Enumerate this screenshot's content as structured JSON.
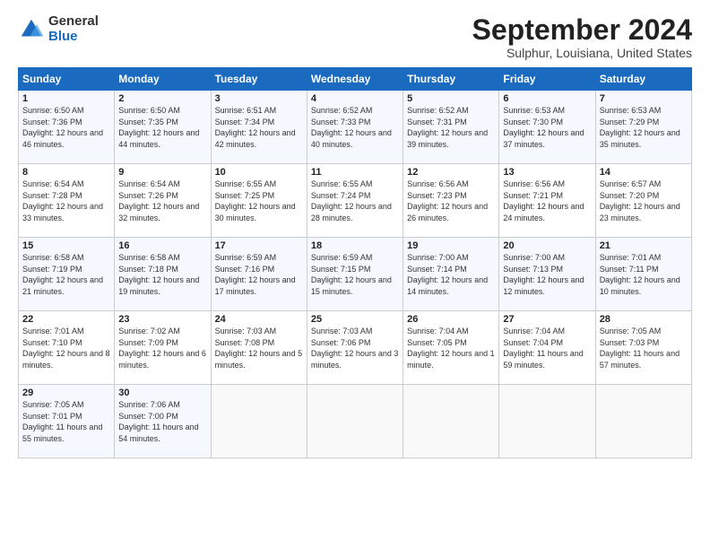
{
  "logo": {
    "general": "General",
    "blue": "Blue"
  },
  "header": {
    "month": "September 2024",
    "location": "Sulphur, Louisiana, United States"
  },
  "weekdays": [
    "Sunday",
    "Monday",
    "Tuesday",
    "Wednesday",
    "Thursday",
    "Friday",
    "Saturday"
  ],
  "weeks": [
    [
      {
        "day": 1,
        "sunrise": "6:50 AM",
        "sunset": "7:36 PM",
        "daylight": "12 hours and 46 minutes."
      },
      {
        "day": 2,
        "sunrise": "6:50 AM",
        "sunset": "7:35 PM",
        "daylight": "12 hours and 44 minutes."
      },
      {
        "day": 3,
        "sunrise": "6:51 AM",
        "sunset": "7:34 PM",
        "daylight": "12 hours and 42 minutes."
      },
      {
        "day": 4,
        "sunrise": "6:52 AM",
        "sunset": "7:33 PM",
        "daylight": "12 hours and 40 minutes."
      },
      {
        "day": 5,
        "sunrise": "6:52 AM",
        "sunset": "7:31 PM",
        "daylight": "12 hours and 39 minutes."
      },
      {
        "day": 6,
        "sunrise": "6:53 AM",
        "sunset": "7:30 PM",
        "daylight": "12 hours and 37 minutes."
      },
      {
        "day": 7,
        "sunrise": "6:53 AM",
        "sunset": "7:29 PM",
        "daylight": "12 hours and 35 minutes."
      }
    ],
    [
      {
        "day": 8,
        "sunrise": "6:54 AM",
        "sunset": "7:28 PM",
        "daylight": "12 hours and 33 minutes."
      },
      {
        "day": 9,
        "sunrise": "6:54 AM",
        "sunset": "7:26 PM",
        "daylight": "12 hours and 32 minutes."
      },
      {
        "day": 10,
        "sunrise": "6:55 AM",
        "sunset": "7:25 PM",
        "daylight": "12 hours and 30 minutes."
      },
      {
        "day": 11,
        "sunrise": "6:55 AM",
        "sunset": "7:24 PM",
        "daylight": "12 hours and 28 minutes."
      },
      {
        "day": 12,
        "sunrise": "6:56 AM",
        "sunset": "7:23 PM",
        "daylight": "12 hours and 26 minutes."
      },
      {
        "day": 13,
        "sunrise": "6:56 AM",
        "sunset": "7:21 PM",
        "daylight": "12 hours and 24 minutes."
      },
      {
        "day": 14,
        "sunrise": "6:57 AM",
        "sunset": "7:20 PM",
        "daylight": "12 hours and 23 minutes."
      }
    ],
    [
      {
        "day": 15,
        "sunrise": "6:58 AM",
        "sunset": "7:19 PM",
        "daylight": "12 hours and 21 minutes."
      },
      {
        "day": 16,
        "sunrise": "6:58 AM",
        "sunset": "7:18 PM",
        "daylight": "12 hours and 19 minutes."
      },
      {
        "day": 17,
        "sunrise": "6:59 AM",
        "sunset": "7:16 PM",
        "daylight": "12 hours and 17 minutes."
      },
      {
        "day": 18,
        "sunrise": "6:59 AM",
        "sunset": "7:15 PM",
        "daylight": "12 hours and 15 minutes."
      },
      {
        "day": 19,
        "sunrise": "7:00 AM",
        "sunset": "7:14 PM",
        "daylight": "12 hours and 14 minutes."
      },
      {
        "day": 20,
        "sunrise": "7:00 AM",
        "sunset": "7:13 PM",
        "daylight": "12 hours and 12 minutes."
      },
      {
        "day": 21,
        "sunrise": "7:01 AM",
        "sunset": "7:11 PM",
        "daylight": "12 hours and 10 minutes."
      }
    ],
    [
      {
        "day": 22,
        "sunrise": "7:01 AM",
        "sunset": "7:10 PM",
        "daylight": "12 hours and 8 minutes."
      },
      {
        "day": 23,
        "sunrise": "7:02 AM",
        "sunset": "7:09 PM",
        "daylight": "12 hours and 6 minutes."
      },
      {
        "day": 24,
        "sunrise": "7:03 AM",
        "sunset": "7:08 PM",
        "daylight": "12 hours and 5 minutes."
      },
      {
        "day": 25,
        "sunrise": "7:03 AM",
        "sunset": "7:06 PM",
        "daylight": "12 hours and 3 minutes."
      },
      {
        "day": 26,
        "sunrise": "7:04 AM",
        "sunset": "7:05 PM",
        "daylight": "12 hours and 1 minute."
      },
      {
        "day": 27,
        "sunrise": "7:04 AM",
        "sunset": "7:04 PM",
        "daylight": "11 hours and 59 minutes."
      },
      {
        "day": 28,
        "sunrise": "7:05 AM",
        "sunset": "7:03 PM",
        "daylight": "11 hours and 57 minutes."
      }
    ],
    [
      {
        "day": 29,
        "sunrise": "7:05 AM",
        "sunset": "7:01 PM",
        "daylight": "11 hours and 55 minutes."
      },
      {
        "day": 30,
        "sunrise": "7:06 AM",
        "sunset": "7:00 PM",
        "daylight": "11 hours and 54 minutes."
      },
      null,
      null,
      null,
      null,
      null
    ]
  ]
}
